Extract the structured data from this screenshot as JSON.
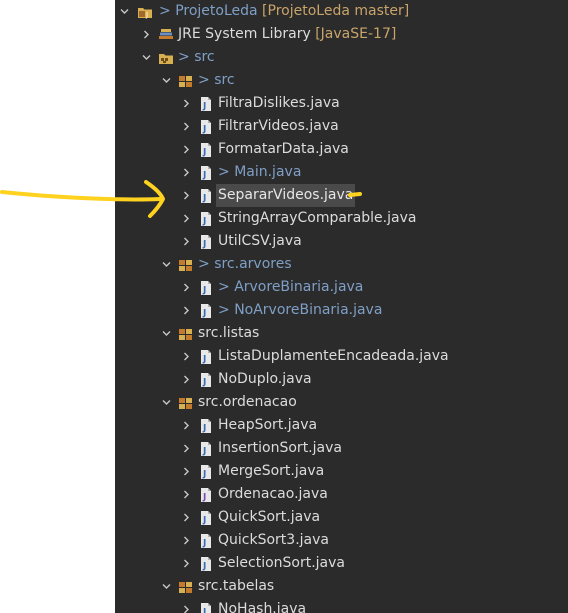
{
  "explorer": {
    "project": {
      "label": "ProjetoLeda",
      "git_prefix": ">",
      "repo_info": "[ProjetoLeda master]"
    },
    "jre": {
      "label": "JRE System Library",
      "version": "[JavaSE-17]"
    },
    "src_folder": {
      "git_prefix": ">",
      "label": "src"
    },
    "packages": {
      "src": {
        "git_prefix": ">",
        "label": "src",
        "files": [
          {
            "label": "FiltraDislikes.java"
          },
          {
            "label": "FiltrarVideos.java"
          },
          {
            "label": "FormatarData.java"
          },
          {
            "git_prefix": ">",
            "label": "Main.java"
          },
          {
            "label": "SepararVideos.java"
          },
          {
            "label": "StringArrayComparable.java"
          },
          {
            "label": "UtilCSV.java"
          }
        ]
      },
      "arvores": {
        "git_prefix": ">",
        "label": "src.arvores",
        "files": [
          {
            "git_prefix": ">",
            "label": "ArvoreBinaria.java"
          },
          {
            "git_prefix": ">",
            "label": "NoArvoreBinaria.java"
          }
        ]
      },
      "listas": {
        "label": "src.listas",
        "files": [
          {
            "label": "ListaDuplamenteEncadeada.java"
          },
          {
            "label": "NoDuplo.java"
          }
        ]
      },
      "ordenacao": {
        "label": "src.ordenacao",
        "files": [
          {
            "label": "HeapSort.java"
          },
          {
            "label": "InsertionSort.java"
          },
          {
            "label": "MergeSort.java"
          },
          {
            "label": "Ordenacao.java"
          },
          {
            "label": "QuickSort.java"
          },
          {
            "label": "QuickSort3.java"
          },
          {
            "label": "SelectionSort.java"
          }
        ]
      },
      "tabelas": {
        "label": "src.tabelas",
        "files": [
          {
            "label": "NoHash.java"
          }
        ]
      }
    }
  },
  "colors": {
    "panel_background": "#2b2b2b",
    "text": "#dcdcdc",
    "git_decoration": "#7f9fc6",
    "repo_decoration": "#c8a46a",
    "selection": "#4a4a4a",
    "annotation_arrow": "#ffd21f"
  },
  "icons": {
    "expanded": "chevron-down-icon",
    "collapsed": "chevron-right-icon",
    "project": "java-project-icon",
    "library": "library-icon",
    "source_folder": "source-folder-icon",
    "package": "package-icon",
    "java_file": "java-file-icon"
  }
}
